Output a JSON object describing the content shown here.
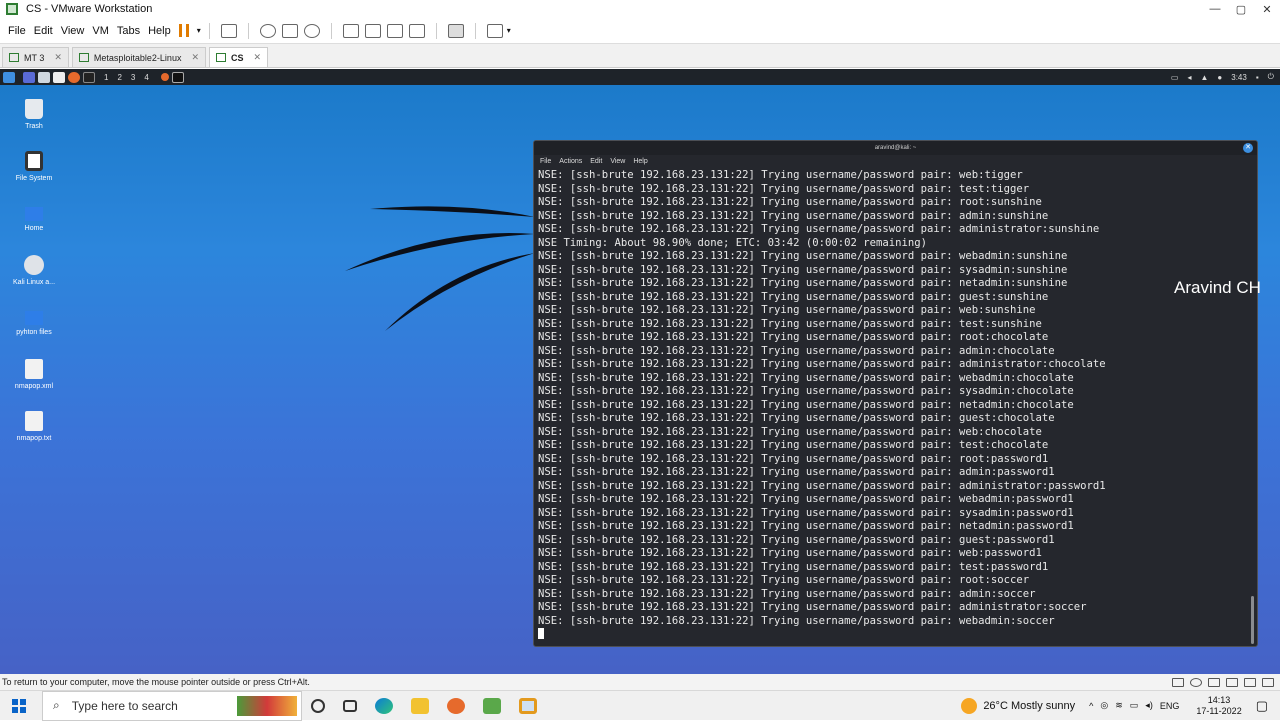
{
  "window": {
    "title": "CS - VMware Workstation",
    "menu": [
      "File",
      "Edit",
      "View",
      "VM",
      "Tabs",
      "Help"
    ]
  },
  "tabs": [
    {
      "label": "MT 3"
    },
    {
      "label": "Metasploitable2-Linux"
    },
    {
      "label": "CS"
    }
  ],
  "kali_panel": {
    "workspaces": [
      "1",
      "2",
      "3",
      "4"
    ],
    "time": "3:43"
  },
  "desktop_icons": [
    {
      "label": "Trash",
      "icon": "trash-icon"
    },
    {
      "label": "File System",
      "icon": "drive-icon"
    },
    {
      "label": "Home",
      "icon": "home-folder-icon"
    },
    {
      "label": "Kali Linux a...",
      "icon": "disc-icon"
    },
    {
      "label": "pyhton files",
      "icon": "folder-icon"
    },
    {
      "label": "nmapop.xml",
      "icon": "xml-file-icon"
    },
    {
      "label": "nmapop.txt",
      "icon": "text-file-icon"
    }
  ],
  "terminal": {
    "title": "aravind@kali: ~",
    "menu": [
      "File",
      "Actions",
      "Edit",
      "View",
      "Help"
    ],
    "lines": [
      "NSE: [ssh-brute 192.168.23.131:22] Trying username/password pair: web:tigger",
      "NSE: [ssh-brute 192.168.23.131:22] Trying username/password pair: test:tigger",
      "NSE: [ssh-brute 192.168.23.131:22] Trying username/password pair: root:sunshine",
      "NSE: [ssh-brute 192.168.23.131:22] Trying username/password pair: admin:sunshine",
      "NSE: [ssh-brute 192.168.23.131:22] Trying username/password pair: administrator:sunshine",
      "NSE Timing: About 98.90% done; ETC: 03:42 (0:00:02 remaining)",
      "NSE: [ssh-brute 192.168.23.131:22] Trying username/password pair: webadmin:sunshine",
      "NSE: [ssh-brute 192.168.23.131:22] Trying username/password pair: sysadmin:sunshine",
      "NSE: [ssh-brute 192.168.23.131:22] Trying username/password pair: netadmin:sunshine",
      "NSE: [ssh-brute 192.168.23.131:22] Trying username/password pair: guest:sunshine",
      "NSE: [ssh-brute 192.168.23.131:22] Trying username/password pair: web:sunshine",
      "NSE: [ssh-brute 192.168.23.131:22] Trying username/password pair: test:sunshine",
      "NSE: [ssh-brute 192.168.23.131:22] Trying username/password pair: root:chocolate",
      "NSE: [ssh-brute 192.168.23.131:22] Trying username/password pair: admin:chocolate",
      "NSE: [ssh-brute 192.168.23.131:22] Trying username/password pair: administrator:chocolate",
      "NSE: [ssh-brute 192.168.23.131:22] Trying username/password pair: webadmin:chocolate",
      "NSE: [ssh-brute 192.168.23.131:22] Trying username/password pair: sysadmin:chocolate",
      "NSE: [ssh-brute 192.168.23.131:22] Trying username/password pair: netadmin:chocolate",
      "NSE: [ssh-brute 192.168.23.131:22] Trying username/password pair: guest:chocolate",
      "NSE: [ssh-brute 192.168.23.131:22] Trying username/password pair: web:chocolate",
      "NSE: [ssh-brute 192.168.23.131:22] Trying username/password pair: test:chocolate",
      "NSE: [ssh-brute 192.168.23.131:22] Trying username/password pair: root:password1",
      "NSE: [ssh-brute 192.168.23.131:22] Trying username/password pair: admin:password1",
      "NSE: [ssh-brute 192.168.23.131:22] Trying username/password pair: administrator:password1",
      "NSE: [ssh-brute 192.168.23.131:22] Trying username/password pair: webadmin:password1",
      "NSE: [ssh-brute 192.168.23.131:22] Trying username/password pair: sysadmin:password1",
      "NSE: [ssh-brute 192.168.23.131:22] Trying username/password pair: netadmin:password1",
      "NSE: [ssh-brute 192.168.23.131:22] Trying username/password pair: guest:password1",
      "NSE: [ssh-brute 192.168.23.131:22] Trying username/password pair: web:password1",
      "NSE: [ssh-brute 192.168.23.131:22] Trying username/password pair: test:password1",
      "NSE: [ssh-brute 192.168.23.131:22] Trying username/password pair: root:soccer",
      "NSE: [ssh-brute 192.168.23.131:22] Trying username/password pair: admin:soccer",
      "NSE: [ssh-brute 192.168.23.131:22] Trying username/password pair: administrator:soccer",
      "NSE: [ssh-brute 192.168.23.131:22] Trying username/password pair: webadmin:soccer"
    ]
  },
  "watermark": "Aravind CH",
  "status_bar": {
    "message": "To return to your computer, move the mouse pointer outside or press Ctrl+Alt."
  },
  "taskbar": {
    "search_placeholder": "Type here to search",
    "weather": "26°C  Mostly sunny",
    "language": "ENG",
    "time": "14:13",
    "date": "17-11-2022"
  },
  "colors": {
    "terminal_bg": "#25272d",
    "desktop_accent": "#2c86dc",
    "vmware_green": "#2e7d32",
    "pause_orange": "#e07b00"
  }
}
